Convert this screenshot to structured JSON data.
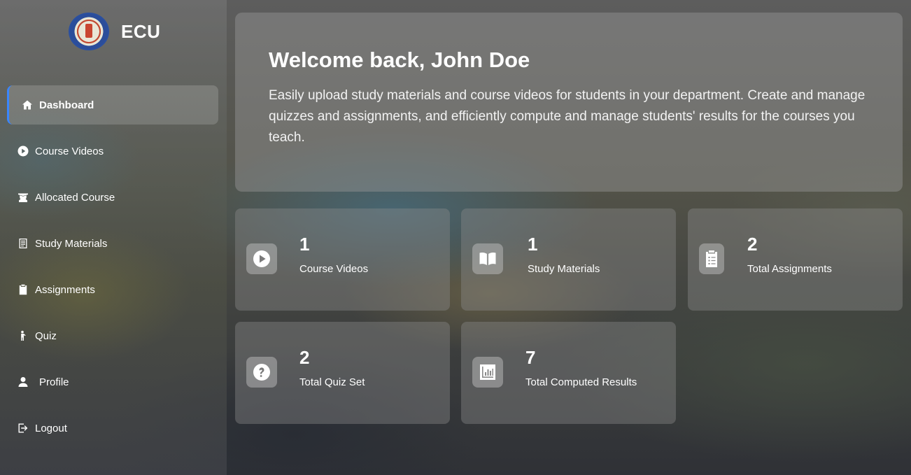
{
  "brand": {
    "name": "ECU"
  },
  "sidebar": {
    "items": [
      {
        "label": "Dashboard",
        "icon": "home-icon",
        "active": true
      },
      {
        "label": "Course Videos",
        "icon": "play-circle-icon"
      },
      {
        "label": "Allocated Course",
        "icon": "graduate-icon"
      },
      {
        "label": "Study Materials",
        "icon": "document-list-icon"
      },
      {
        "label": "Assignments",
        "icon": "clipboard-check-icon"
      },
      {
        "label": "Quiz",
        "icon": "quiz-person-icon"
      },
      {
        "label": "Profile",
        "icon": "user-icon"
      },
      {
        "label": "Logout",
        "icon": "logout-icon"
      }
    ]
  },
  "welcome": {
    "title": "Welcome back, John Doe",
    "text": "Easily upload study materials and course videos for students in your department. Create and manage quizzes and assignments, and efficiently compute and manage students' results for the courses you teach."
  },
  "stats": [
    {
      "count": "1",
      "label": "Course Videos",
      "icon": "play-icon"
    },
    {
      "count": "1",
      "label": "Study Materials",
      "icon": "book-icon"
    },
    {
      "count": "2",
      "label": "Total Assignments",
      "icon": "clipboard-list-icon"
    },
    {
      "count": "2",
      "label": "Total Quiz Set",
      "icon": "question-icon"
    },
    {
      "count": "7",
      "label": "Total Computed Results",
      "icon": "bar-chart-icon"
    }
  ],
  "colors": {
    "accent": "#3a86ff"
  }
}
